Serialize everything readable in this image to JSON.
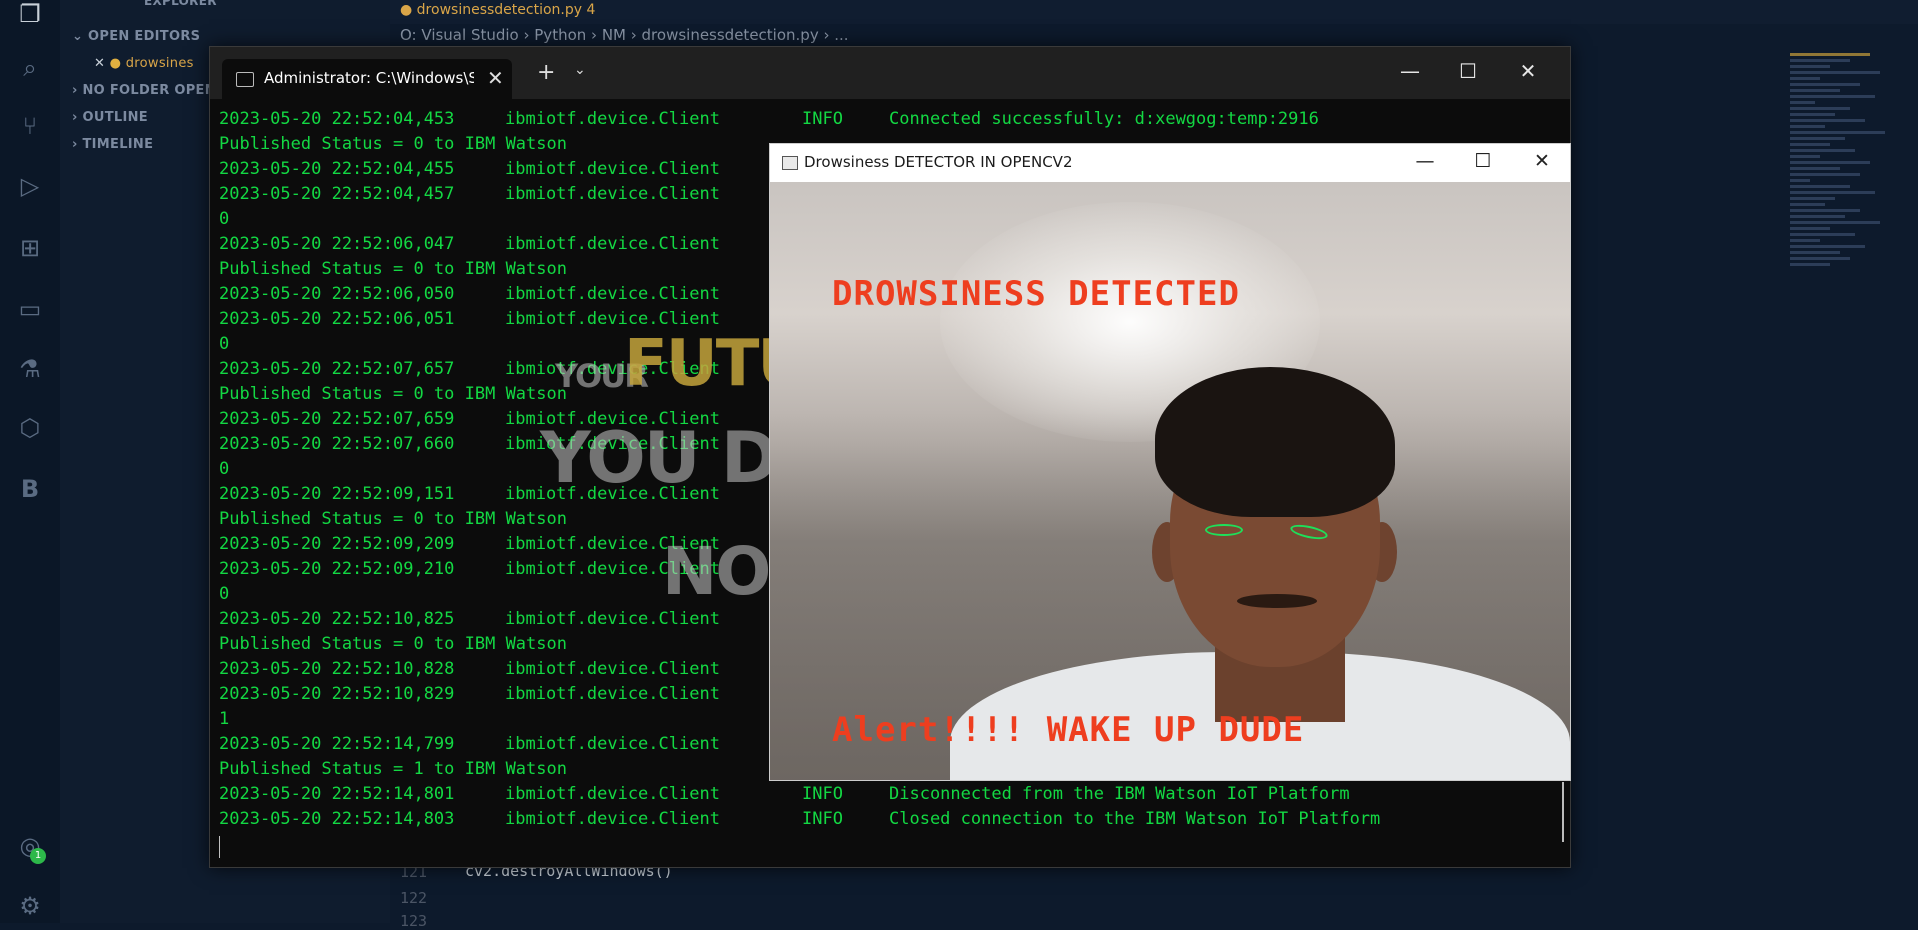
{
  "vscode": {
    "explorer_title": "EXPLORER",
    "sections": {
      "open_editors": "OPEN EDITORS",
      "open_file": "drowsines",
      "no_folder": "NO FOLDER OPENE",
      "outline": "OUTLINE",
      "timeline": "TIMELINE"
    },
    "active_tab": "drowsinessdetection.py 4",
    "breadcrumb": [
      "O:",
      "Visual Studio",
      "Python",
      "NM",
      "drowsinessdetection.py",
      "..."
    ],
    "code": {
      "line_121": "121",
      "line_122": "122",
      "line_123": "123",
      "line_text": "cv2.destroyAllWindows()"
    },
    "notification_badge": "1",
    "accent": "#d9a548"
  },
  "terminal": {
    "tab_title": "Administrator: C:\\Windows\\Sy",
    "lines": [
      {
        "ts": "2023-05-20 22:52:04,453",
        "src": "ibmiotf.device.Client",
        "lvl": "INFO",
        "msg": "Connected successfully: d:xewgog:temp:2916"
      },
      {
        "text": "Published Status = 0 to IBM Watson"
      },
      {
        "ts": "2023-05-20 22:52:04,455",
        "src": "ibmiotf.device.Client",
        "lvl": "",
        "msg": ""
      },
      {
        "ts": "2023-05-20 22:52:04,457",
        "src": "ibmiotf.device.Client",
        "lvl": "",
        "msg": ""
      },
      {
        "text": "0"
      },
      {
        "ts": "2023-05-20 22:52:06,047",
        "src": "ibmiotf.device.Client",
        "lvl": "",
        "msg": ""
      },
      {
        "text": "Published Status = 0 to IBM Watson"
      },
      {
        "ts": "2023-05-20 22:52:06,050",
        "src": "ibmiotf.device.Client",
        "lvl": "",
        "msg": ""
      },
      {
        "ts": "2023-05-20 22:52:06,051",
        "src": "ibmiotf.device.Client",
        "lvl": "",
        "msg": ""
      },
      {
        "text": "0"
      },
      {
        "ts": "2023-05-20 22:52:07,657",
        "src": "ibmiotf.device.Client",
        "lvl": "",
        "msg": ""
      },
      {
        "text": "Published Status = 0 to IBM Watson"
      },
      {
        "ts": "2023-05-20 22:52:07,659",
        "src": "ibmiotf.device.Client",
        "lvl": "",
        "msg": ""
      },
      {
        "ts": "2023-05-20 22:52:07,660",
        "src": "ibmiotf.device.Client",
        "lvl": "",
        "msg": ""
      },
      {
        "text": "0"
      },
      {
        "ts": "2023-05-20 22:52:09,151",
        "src": "ibmiotf.device.Client",
        "lvl": "",
        "msg": ""
      },
      {
        "text": "Published Status = 0 to IBM Watson"
      },
      {
        "ts": "2023-05-20 22:52:09,209",
        "src": "ibmiotf.device.Client",
        "lvl": "",
        "msg": ""
      },
      {
        "ts": "2023-05-20 22:52:09,210",
        "src": "ibmiotf.device.Client",
        "lvl": "",
        "msg": ""
      },
      {
        "text": "0"
      },
      {
        "ts": "2023-05-20 22:52:10,825",
        "src": "ibmiotf.device.Client",
        "lvl": "",
        "msg": ""
      },
      {
        "text": "Published Status = 0 to IBM Watson"
      },
      {
        "ts": "2023-05-20 22:52:10,828",
        "src": "ibmiotf.device.Client",
        "lvl": "",
        "msg": ""
      },
      {
        "ts": "2023-05-20 22:52:10,829",
        "src": "ibmiotf.device.Client",
        "lvl": "",
        "msg": ""
      },
      {
        "text": "1"
      },
      {
        "ts": "2023-05-20 22:52:14,799",
        "src": "ibmiotf.device.Client",
        "lvl": "",
        "msg": ""
      },
      {
        "text": "Published Status = 1 to IBM Watson"
      },
      {
        "ts": "2023-05-20 22:52:14,801",
        "src": "ibmiotf.device.Client",
        "lvl": "INFO",
        "msg": "Disconnected from the IBM Watson IoT Platform"
      },
      {
        "ts": "2023-05-20 22:52:14,803",
        "src": "ibmiotf.device.Client",
        "lvl": "INFO",
        "msg": "Closed connection to the IBM Watson IoT Platform"
      }
    ],
    "overlay_words": {
      "your": "YOUR",
      "future": "FUTUR",
      "you_do": "YOU DO",
      "not": "NOT"
    },
    "text_color": "#13d843"
  },
  "opencv_window": {
    "title": "Drowsiness DETECTOR IN OPENCV2",
    "top_label": "DROWSINESS DETECTED",
    "bottom_label": "Alert!!!! WAKE UP DUDE",
    "label_color": "#ee3e1f",
    "contour_color": "#1ee05a"
  }
}
